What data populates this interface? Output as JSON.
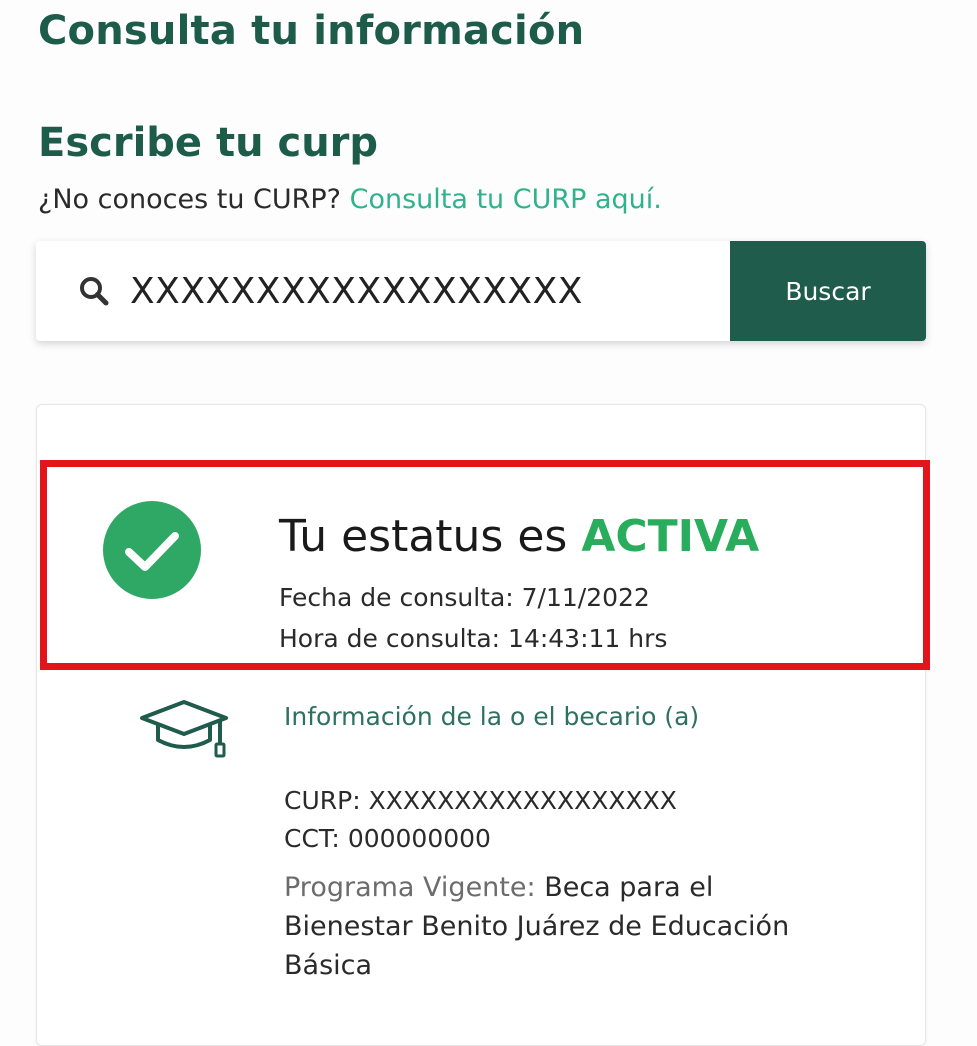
{
  "header": {
    "title": "Consulta tu información"
  },
  "curp_section": {
    "title": "Escribe tu curp",
    "help_text": "¿No conoces tu CURP?",
    "help_link": "Consulta tu CURP aquí."
  },
  "search": {
    "icon": "search-icon",
    "value": "XXXXXXXXXXXXXXXXXX",
    "button_label": "Buscar"
  },
  "status": {
    "icon": "check-circle-icon",
    "heading_prefix": "Tu estatus es",
    "value": "ACTIVA",
    "date_label": "Fecha de consulta:",
    "date": "7/11/2022",
    "time_label": "Hora de consulta:",
    "time": "14:43:11 hrs"
  },
  "becario": {
    "icon": "graduation-cap-icon",
    "title": "Información de la o el becario (a)",
    "curp_label": "CURP:",
    "curp": "XXXXXXXXXXXXXXXXXX",
    "cct_label": "CCT:",
    "cct": "000000000",
    "program_label": "Programa Vigente:",
    "program": "Beca para el Bienestar Benito Juárez de Educación Básica"
  },
  "colors": {
    "brand_green": "#1f5c4b",
    "link_green": "#2fb48a",
    "status_green": "#27ad5c",
    "highlight_red": "#e3141b"
  }
}
